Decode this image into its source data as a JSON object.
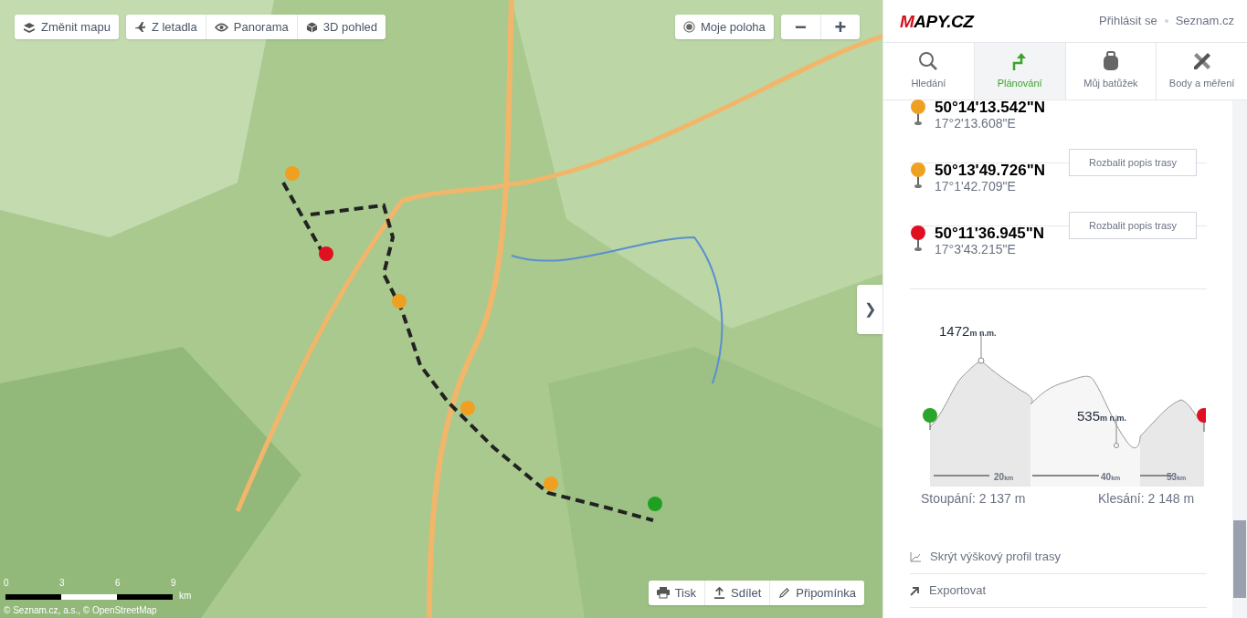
{
  "map_toolbar": {
    "change_map": "Změnit mapu",
    "views": [
      "Z letadla",
      "Panorama",
      "3D pohled"
    ],
    "my_location": "Moje poloha",
    "zoom_out": "−",
    "zoom_in": "+"
  },
  "map": {
    "kind": "picture"
  },
  "panel_toggle": "❯",
  "scale": {
    "ticks": [
      "0",
      "3",
      "6",
      "9"
    ],
    "unit": "km"
  },
  "attribution": "© Seznam.cz, a.s., © OpenStreetMap",
  "map_actions": [
    "Tisk",
    "Sdílet",
    "Připomínka"
  ],
  "header": {
    "logo": "MAPY.CZ",
    "links": [
      "Přihlásit se",
      "Seznam.cz"
    ]
  },
  "tabs": [
    {
      "label": "Hledání",
      "selected": false
    },
    {
      "label": "Plánování",
      "selected": true
    },
    {
      "label": "Můj batůžek",
      "selected": false
    },
    {
      "label": "Body a měření",
      "selected": false
    }
  ],
  "waypoints": [
    {
      "lat": "50°14'13.542\"N",
      "lon": "17°2'13.608\"E",
      "color": "#f0a020",
      "action": "Rozbalit popis trasy"
    },
    {
      "lat": "50°13'49.726\"N",
      "lon": "17°1'42.709\"E",
      "color": "#f0a020",
      "action": "Rozbalit popis trasy"
    },
    {
      "lat": "50°11'36.945\"N",
      "lon": "17°3'43.215\"E",
      "color": "#e01020"
    }
  ],
  "profile": {
    "max": {
      "value": "1472",
      "unit": "m n.m."
    },
    "min": {
      "value": "535",
      "unit": "m n.m."
    },
    "distances": [
      {
        "value": "20",
        "unit": "km"
      },
      {
        "value": "40",
        "unit": "km"
      },
      {
        "value": "53",
        "unit": "km"
      }
    ],
    "ascent": "Stoupání: 2 137 m",
    "descent": "Klesání: 2 148 m"
  },
  "links": [
    {
      "kind": "profile",
      "label": "Skrýt výškový profil trasy"
    },
    {
      "kind": "export",
      "label": "Exportovat"
    }
  ]
}
